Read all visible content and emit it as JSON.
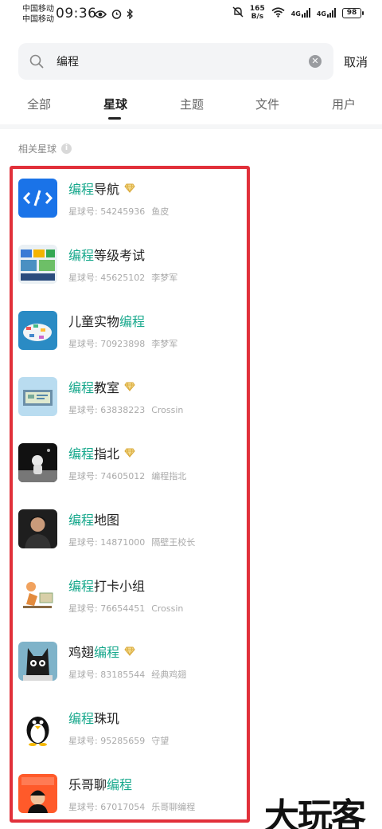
{
  "status_bar": {
    "carrier_1": "中国移动",
    "carrier_2": "中国移动",
    "time": "09:36",
    "net_speed": "165",
    "net_unit": "B/s",
    "signal_1": "4G",
    "signal_2": "4G",
    "battery": "98"
  },
  "search": {
    "query": "编程",
    "cancel_label": "取消"
  },
  "tabs": [
    {
      "label": "全部"
    },
    {
      "label": "星球"
    },
    {
      "label": "主题"
    },
    {
      "label": "文件"
    },
    {
      "label": "用户"
    }
  ],
  "active_tab": "星球",
  "section_title": "相关星球",
  "id_prefix": "星球号: ",
  "accent_color": "#17a88c",
  "highlight_color": "#e1303a",
  "planets": [
    {
      "pre": "",
      "hl": "编程",
      "post": "导航",
      "vip": true,
      "id": "星球号: 54245936",
      "owner": "鱼皮"
    },
    {
      "pre": "",
      "hl": "编程",
      "post": "等级考试",
      "vip": false,
      "id": "星球号: 45625102",
      "owner": "李梦军"
    },
    {
      "pre": "儿童实物",
      "hl": "编程",
      "post": "",
      "vip": false,
      "id": "星球号: 70923898",
      "owner": "李梦军"
    },
    {
      "pre": "",
      "hl": "编程",
      "post": "教室",
      "vip": true,
      "id": "星球号: 63838223",
      "owner": "Crossin"
    },
    {
      "pre": "",
      "hl": "编程",
      "post": "指北",
      "vip": true,
      "id": "星球号: 74605012",
      "owner": "编程指北"
    },
    {
      "pre": "",
      "hl": "编程",
      "post": "地图",
      "vip": false,
      "id": "星球号: 14871000",
      "owner": "隔壁王校长"
    },
    {
      "pre": "",
      "hl": "编程",
      "post": "打卡小组",
      "vip": false,
      "id": "星球号: 76654451",
      "owner": "Crossin"
    },
    {
      "pre": "鸡翅",
      "hl": "编程",
      "post": "",
      "vip": true,
      "id": "星球号: 83185544",
      "owner": "经典鸡翅"
    },
    {
      "pre": "",
      "hl": "编程",
      "post": "珠玑",
      "vip": false,
      "id": "星球号: 95285659",
      "owner": "守望"
    },
    {
      "pre": "乐哥聊",
      "hl": "编程",
      "post": "",
      "vip": false,
      "id": "星球号: 67017054",
      "owner": "乐哥聊编程"
    }
  ],
  "watermark": "大玩客"
}
